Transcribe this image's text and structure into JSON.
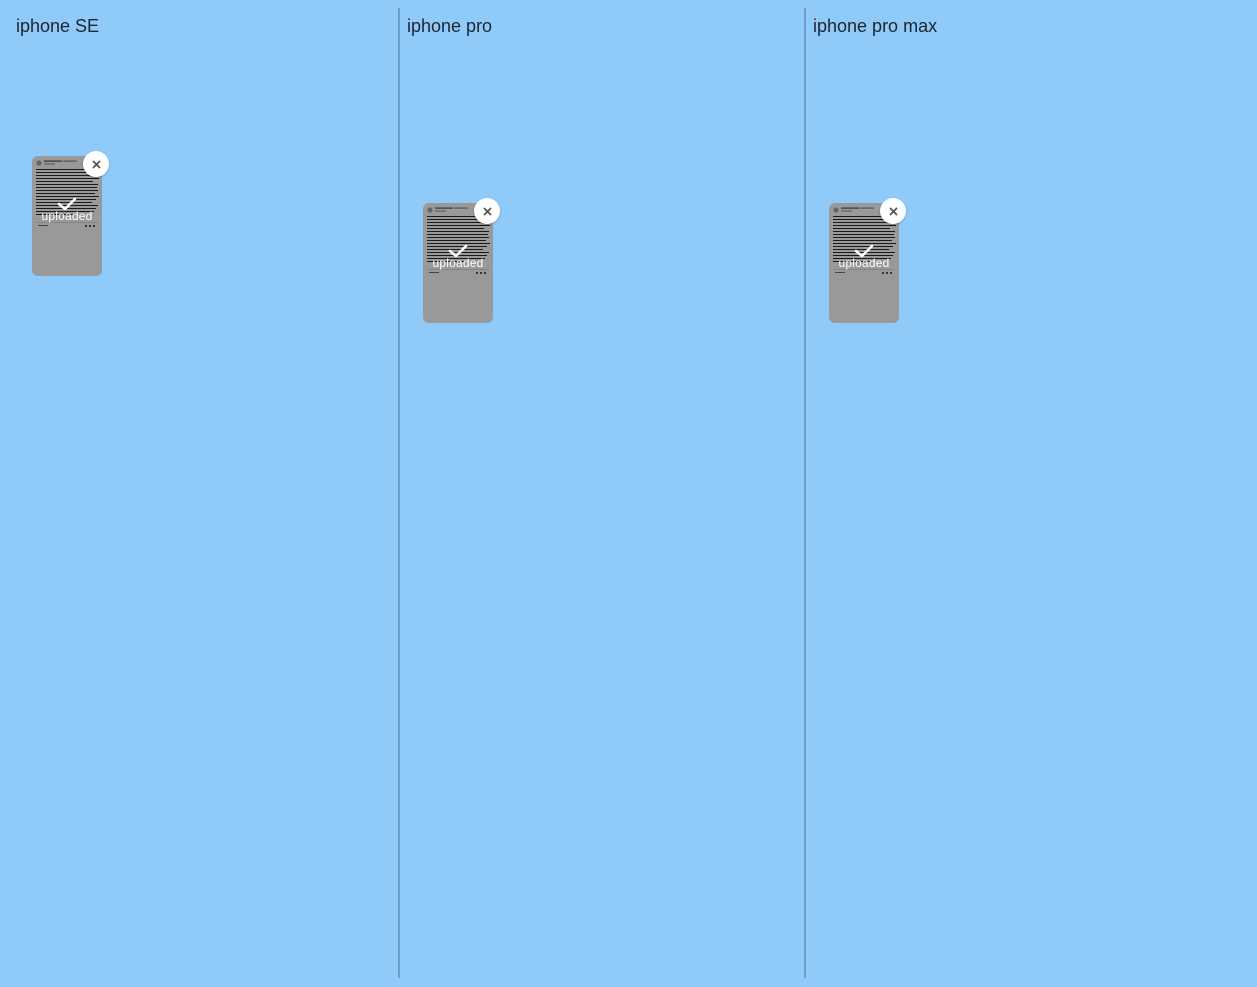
{
  "colors": {
    "background": "#90caf9",
    "divider": "#6f9ecb",
    "thumbnail": "#999999",
    "text": "#1c2530"
  },
  "columns": [
    {
      "label": "iphone SE",
      "upload": {
        "status_text": "uploaded",
        "status_icon": "check-icon",
        "remove_icon": "close-icon"
      }
    },
    {
      "label": "iphone pro",
      "upload": {
        "status_text": "uploaded",
        "status_icon": "check-icon",
        "remove_icon": "close-icon"
      }
    },
    {
      "label": "iphone pro max",
      "upload": {
        "status_text": "uploaded",
        "status_icon": "check-icon",
        "remove_icon": "close-icon"
      }
    }
  ]
}
